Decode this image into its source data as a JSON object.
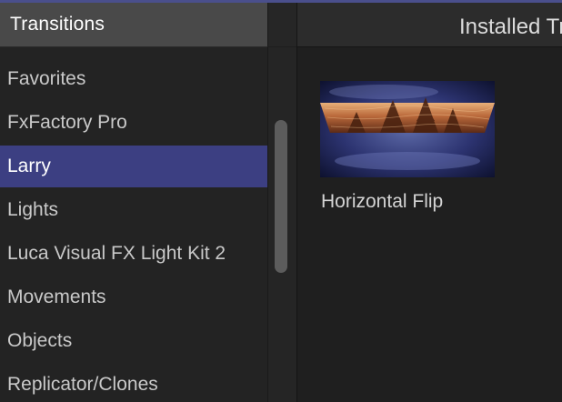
{
  "left_panel": {
    "title": "Transitions"
  },
  "right_panel": {
    "title": "Installed Transitions"
  },
  "sidebar": {
    "items": [
      {
        "label": "Favorites"
      },
      {
        "label": "FxFactory Pro"
      },
      {
        "label": "Larry",
        "selected": true
      },
      {
        "label": "Lights"
      },
      {
        "label": "Luca Visual FX Light Kit 2"
      },
      {
        "label": "Movements"
      },
      {
        "label": "Objects"
      },
      {
        "label": "Replicator/Clones"
      }
    ]
  },
  "browser": {
    "items": [
      {
        "label": "Horizontal Flip",
        "thumbnail": "flip-forest-thumbnail"
      }
    ]
  },
  "colors": {
    "selection": "#3c3f82",
    "accent_line": "#4a4f8c",
    "panel_header": "#494949",
    "background": "#1e1e1e"
  }
}
